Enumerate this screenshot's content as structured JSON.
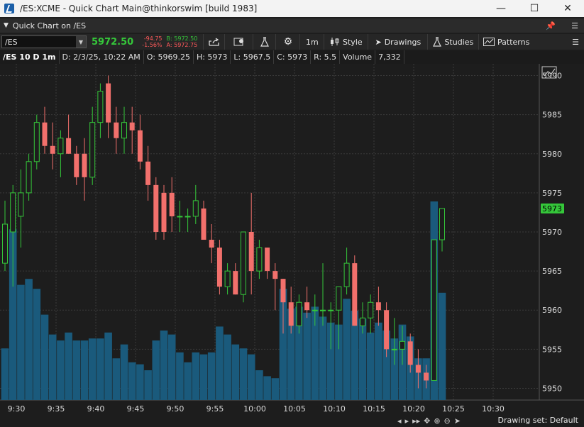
{
  "window": {
    "title": "/ES:XCME - Quick Chart Main@thinkorswim [build 1983]",
    "min": "—",
    "max": "☐",
    "close": "✕"
  },
  "quick_chart": {
    "label": "Quick Chart on /ES"
  },
  "toolbar": {
    "symbol": "/ES",
    "last": "5972.50",
    "net_change": "-94.75",
    "pct_change": "-1.56%",
    "bid": "B: 5972.50",
    "ask": "A: 5972.75",
    "timeframe": "1m",
    "style": "Style",
    "drawings": "Drawings",
    "studies": "Studies",
    "patterns": "Patterns"
  },
  "infobar": {
    "title": "/ES 10 D 1m",
    "date": "D: 2/3/25, 10:22 AM",
    "open": "O: 5969.25",
    "high": "H: 5973",
    "low": "L: 5967.5",
    "close": "C: 5973",
    "range": "R: 5.5",
    "volume_label": "Volume",
    "volume_value": "7,332"
  },
  "bottom": {
    "drawing_set": "Drawing set: Default"
  },
  "colors": {
    "up": "#35c73a",
    "down": "#f2706c",
    "volume": "#1a5a7c",
    "grid": "#3a3a3a",
    "last_price_tag": "#35c73a"
  },
  "chart_data": {
    "type": "candlestick",
    "y_ticks": [
      5950,
      5955,
      5960,
      5965,
      5970,
      5975,
      5980,
      5985,
      5990
    ],
    "ylim": [
      5948.5,
      5991.5
    ],
    "x_ticks": [
      "9:30",
      "9:35",
      "9:40",
      "9:45",
      "9:50",
      "9:55",
      "10:00",
      "10:05",
      "10:10",
      "10:15",
      "10:20",
      "10:25",
      "10:30"
    ],
    "last_price_label": "5973",
    "last_price": 5973,
    "grid": true,
    "candles": [
      {
        "o": 5966,
        "h": 5974,
        "l": 5965,
        "c": 5971,
        "v": 0.26
      },
      {
        "o": 5970,
        "h": 5976,
        "l": 5963,
        "c": 5975,
        "v": 0.86
      },
      {
        "o": 5972,
        "h": 5978,
        "l": 5968,
        "c": 5975,
        "v": 0.58
      },
      {
        "o": 5975,
        "h": 5980,
        "l": 5974,
        "c": 5979,
        "v": 0.61
      },
      {
        "o": 5979,
        "h": 5985,
        "l": 5978,
        "c": 5984,
        "v": 0.56
      },
      {
        "o": 5984,
        "h": 5986,
        "l": 5980,
        "c": 5981,
        "v": 0.43
      },
      {
        "o": 5981,
        "h": 5984,
        "l": 5978,
        "c": 5980,
        "v": 0.33
      },
      {
        "o": 5980,
        "h": 5983,
        "l": 5977,
        "c": 5982,
        "v": 0.3
      },
      {
        "o": 5982,
        "h": 5985,
        "l": 5980,
        "c": 5980,
        "v": 0.34
      },
      {
        "o": 5980,
        "h": 5981,
        "l": 5976,
        "c": 5977,
        "v": 0.3
      },
      {
        "o": 5980,
        "h": 5982,
        "l": 5974,
        "c": 5977,
        "v": 0.3
      },
      {
        "o": 5977,
        "h": 5986,
        "l": 5976,
        "c": 5984,
        "v": 0.31
      },
      {
        "o": 5984,
        "h": 5989,
        "l": 5982,
        "c": 5988,
        "v": 0.31
      },
      {
        "o": 5989,
        "h": 5990,
        "l": 5982,
        "c": 5984,
        "v": 0.34
      },
      {
        "o": 5984,
        "h": 5986,
        "l": 5980,
        "c": 5982,
        "v": 0.21
      },
      {
        "o": 5982,
        "h": 5986,
        "l": 5980,
        "c": 5984,
        "v": 0.28
      },
      {
        "o": 5984,
        "h": 5986,
        "l": 5980,
        "c": 5983,
        "v": 0.19
      },
      {
        "o": 5983,
        "h": 5985,
        "l": 5978,
        "c": 5979,
        "v": 0.18
      },
      {
        "o": 5979,
        "h": 5981,
        "l": 5974,
        "c": 5976,
        "v": 0.15
      },
      {
        "o": 5976,
        "h": 5977,
        "l": 5969,
        "c": 5970,
        "v": 0.3
      },
      {
        "o": 5975,
        "h": 5976,
        "l": 5969,
        "c": 5970,
        "v": 0.35
      },
      {
        "o": 5975,
        "h": 5977,
        "l": 5970,
        "c": 5972,
        "v": 0.33
      },
      {
        "o": 5972,
        "h": 5974,
        "l": 5970,
        "c": 5972,
        "v": 0.24
      },
      {
        "o": 5972,
        "h": 5973,
        "l": 5970,
        "c": 5972,
        "v": 0.19
      },
      {
        "o": 5972,
        "h": 5976,
        "l": 5971,
        "c": 5974,
        "v": 0.24
      },
      {
        "o": 5973,
        "h": 5974,
        "l": 5969,
        "c": 5969,
        "v": 0.23
      },
      {
        "o": 5969,
        "h": 5971,
        "l": 5966,
        "c": 5968,
        "v": 0.24
      },
      {
        "o": 5968,
        "h": 5969,
        "l": 5962,
        "c": 5963,
        "v": 0.37
      },
      {
        "o": 5963,
        "h": 5966,
        "l": 5962,
        "c": 5965,
        "v": 0.33
      },
      {
        "o": 5965,
        "h": 5966,
        "l": 5962,
        "c": 5962,
        "v": 0.28
      },
      {
        "o": 5962,
        "h": 5970,
        "l": 5961,
        "c": 5970,
        "v": 0.26
      },
      {
        "o": 5970,
        "h": 5975,
        "l": 5962,
        "c": 5965,
        "v": 0.23
      },
      {
        "o": 5965,
        "h": 5969,
        "l": 5964,
        "c": 5968,
        "v": 0.15
      },
      {
        "o": 5968,
        "h": 5968,
        "l": 5964,
        "c": 5965,
        "v": 0.12
      },
      {
        "o": 5965,
        "h": 5966,
        "l": 5960,
        "c": 5964,
        "v": 0.11
      },
      {
        "o": 5964,
        "h": 5964,
        "l": 5957,
        "c": 5961,
        "v": 0.56
      },
      {
        "o": 5961,
        "h": 5963,
        "l": 5957,
        "c": 5958,
        "v": 0.46
      },
      {
        "o": 5958,
        "h": 5962,
        "l": 5957,
        "c": 5961,
        "v": 0.47
      },
      {
        "o": 5961,
        "h": 5963,
        "l": 5959,
        "c": 5960,
        "v": 0.44
      },
      {
        "o": 5960,
        "h": 5962,
        "l": 5958,
        "c": 5960,
        "v": 0.47
      },
      {
        "o": 5960,
        "h": 5966,
        "l": 5958,
        "c": 5960,
        "v": 0.42
      },
      {
        "o": 5960,
        "h": 5961,
        "l": 5955,
        "c": 5960,
        "v": 0.39
      },
      {
        "o": 5960,
        "h": 5963,
        "l": 5955,
        "c": 5963,
        "v": 0.38
      },
      {
        "o": 5963,
        "h": 5968,
        "l": 5962,
        "c": 5966,
        "v": 0.51
      },
      {
        "o": 5966,
        "h": 5967,
        "l": 5958,
        "c": 5958,
        "v": 0.45
      },
      {
        "o": 5958,
        "h": 5961,
        "l": 5957,
        "c": 5959,
        "v": 0.41
      },
      {
        "o": 5959,
        "h": 5962,
        "l": 5957,
        "c": 5961,
        "v": 0.34
      },
      {
        "o": 5961,
        "h": 5963,
        "l": 5958,
        "c": 5960,
        "v": 0.39
      },
      {
        "o": 5960,
        "h": 5961,
        "l": 5954,
        "c": 5955,
        "v": 0.35
      },
      {
        "o": 5955,
        "h": 5959,
        "l": 5953,
        "c": 5955,
        "v": 0.31
      },
      {
        "o": 5955,
        "h": 5958,
        "l": 5953,
        "c": 5956,
        "v": 0.38
      },
      {
        "o": 5956,
        "h": 5957,
        "l": 5952,
        "c": 5953,
        "v": 0.32
      },
      {
        "o": 5953,
        "h": 5955,
        "l": 5950,
        "c": 5952,
        "v": 0.21
      },
      {
        "o": 5952,
        "h": 5953,
        "l": 5950,
        "c": 5951,
        "v": 0.21
      },
      {
        "o": 5951,
        "h": 5969,
        "l": 5951,
        "c": 5969,
        "v": 1.0
      },
      {
        "o": 5969,
        "h": 5973,
        "l": 5967.5,
        "c": 5973,
        "v": 0.54
      }
    ]
  }
}
